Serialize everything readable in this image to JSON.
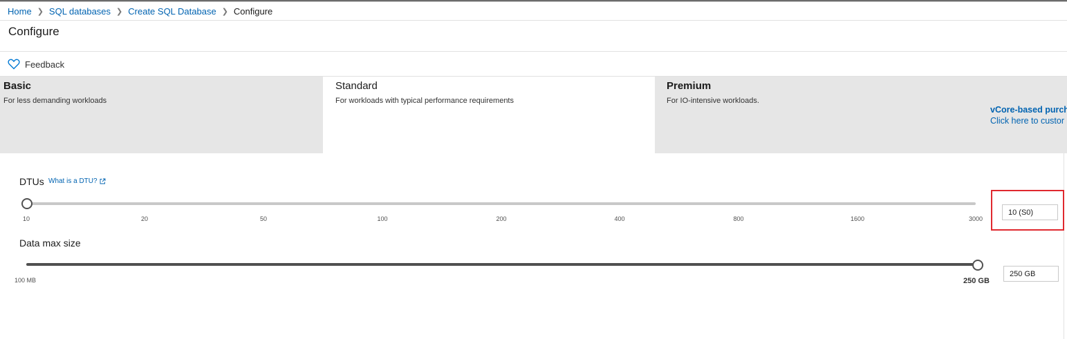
{
  "breadcrumb": {
    "items": [
      "Home",
      "SQL databases",
      "Create SQL Database"
    ],
    "current": "Configure"
  },
  "page": {
    "title": "Configure"
  },
  "toolbar": {
    "feedback_label": "Feedback"
  },
  "tiers": {
    "basic": {
      "name": "Basic",
      "description": "For less demanding workloads"
    },
    "standard": {
      "name": "Standard",
      "description": "For workloads with typical performance requirements"
    },
    "premium": {
      "name": "Premium",
      "description": "For IO-intensive workloads."
    },
    "vcore": {
      "title": "vCore-based purch",
      "subtitle": "Click here to custor"
    }
  },
  "dtu": {
    "label": "DTUs",
    "help_link": "What is a DTU?",
    "ticks": [
      "10",
      "20",
      "50",
      "100",
      "200",
      "400",
      "800",
      "1600",
      "3000"
    ],
    "value": "10 (S0)",
    "selected_fraction": 0
  },
  "max_size": {
    "label": "Data max size",
    "min_label": "100 MB",
    "max_label": "250 GB",
    "value": "250 GB",
    "selected_fraction": 1
  },
  "colors": {
    "link": "#0063b1",
    "tier_inactive_bg": "#e6e6e6",
    "highlight": "#e0282e"
  },
  "icons": {
    "feedback": "heart-icon",
    "external_link": "external-link-icon",
    "breadcrumb_separator": "chevron-right-icon"
  }
}
